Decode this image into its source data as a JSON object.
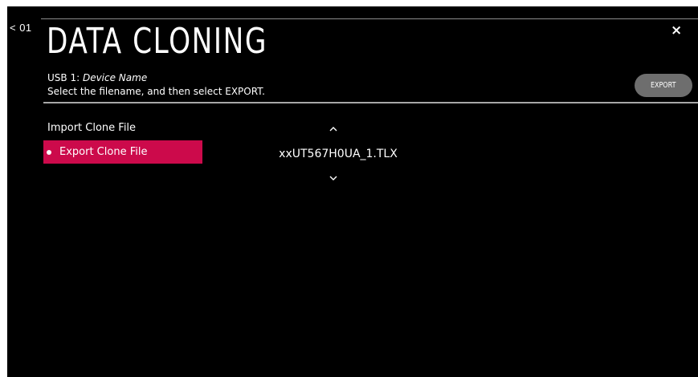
{
  "nav": {
    "back_label": "< 01"
  },
  "header": {
    "title": "DATA CLONING",
    "device_prefix": "USB 1: ",
    "device_name": "Device Name",
    "instruction": "Select the filename, and then select EXPORT.",
    "close_glyph": "×"
  },
  "actions": {
    "export_label": "EXPORT"
  },
  "menu": {
    "items": [
      {
        "label": "Import Clone File",
        "selected": false
      },
      {
        "label": "Export Clone File",
        "selected": true
      }
    ]
  },
  "file_selector": {
    "filename": "xxUT567H0UA_1.TLX",
    "up_icon": "chevron-up-icon",
    "down_icon": "chevron-down-icon"
  },
  "colors": {
    "background": "#000000",
    "accent": "#cc0a4b",
    "button": "#6e6e6e"
  }
}
